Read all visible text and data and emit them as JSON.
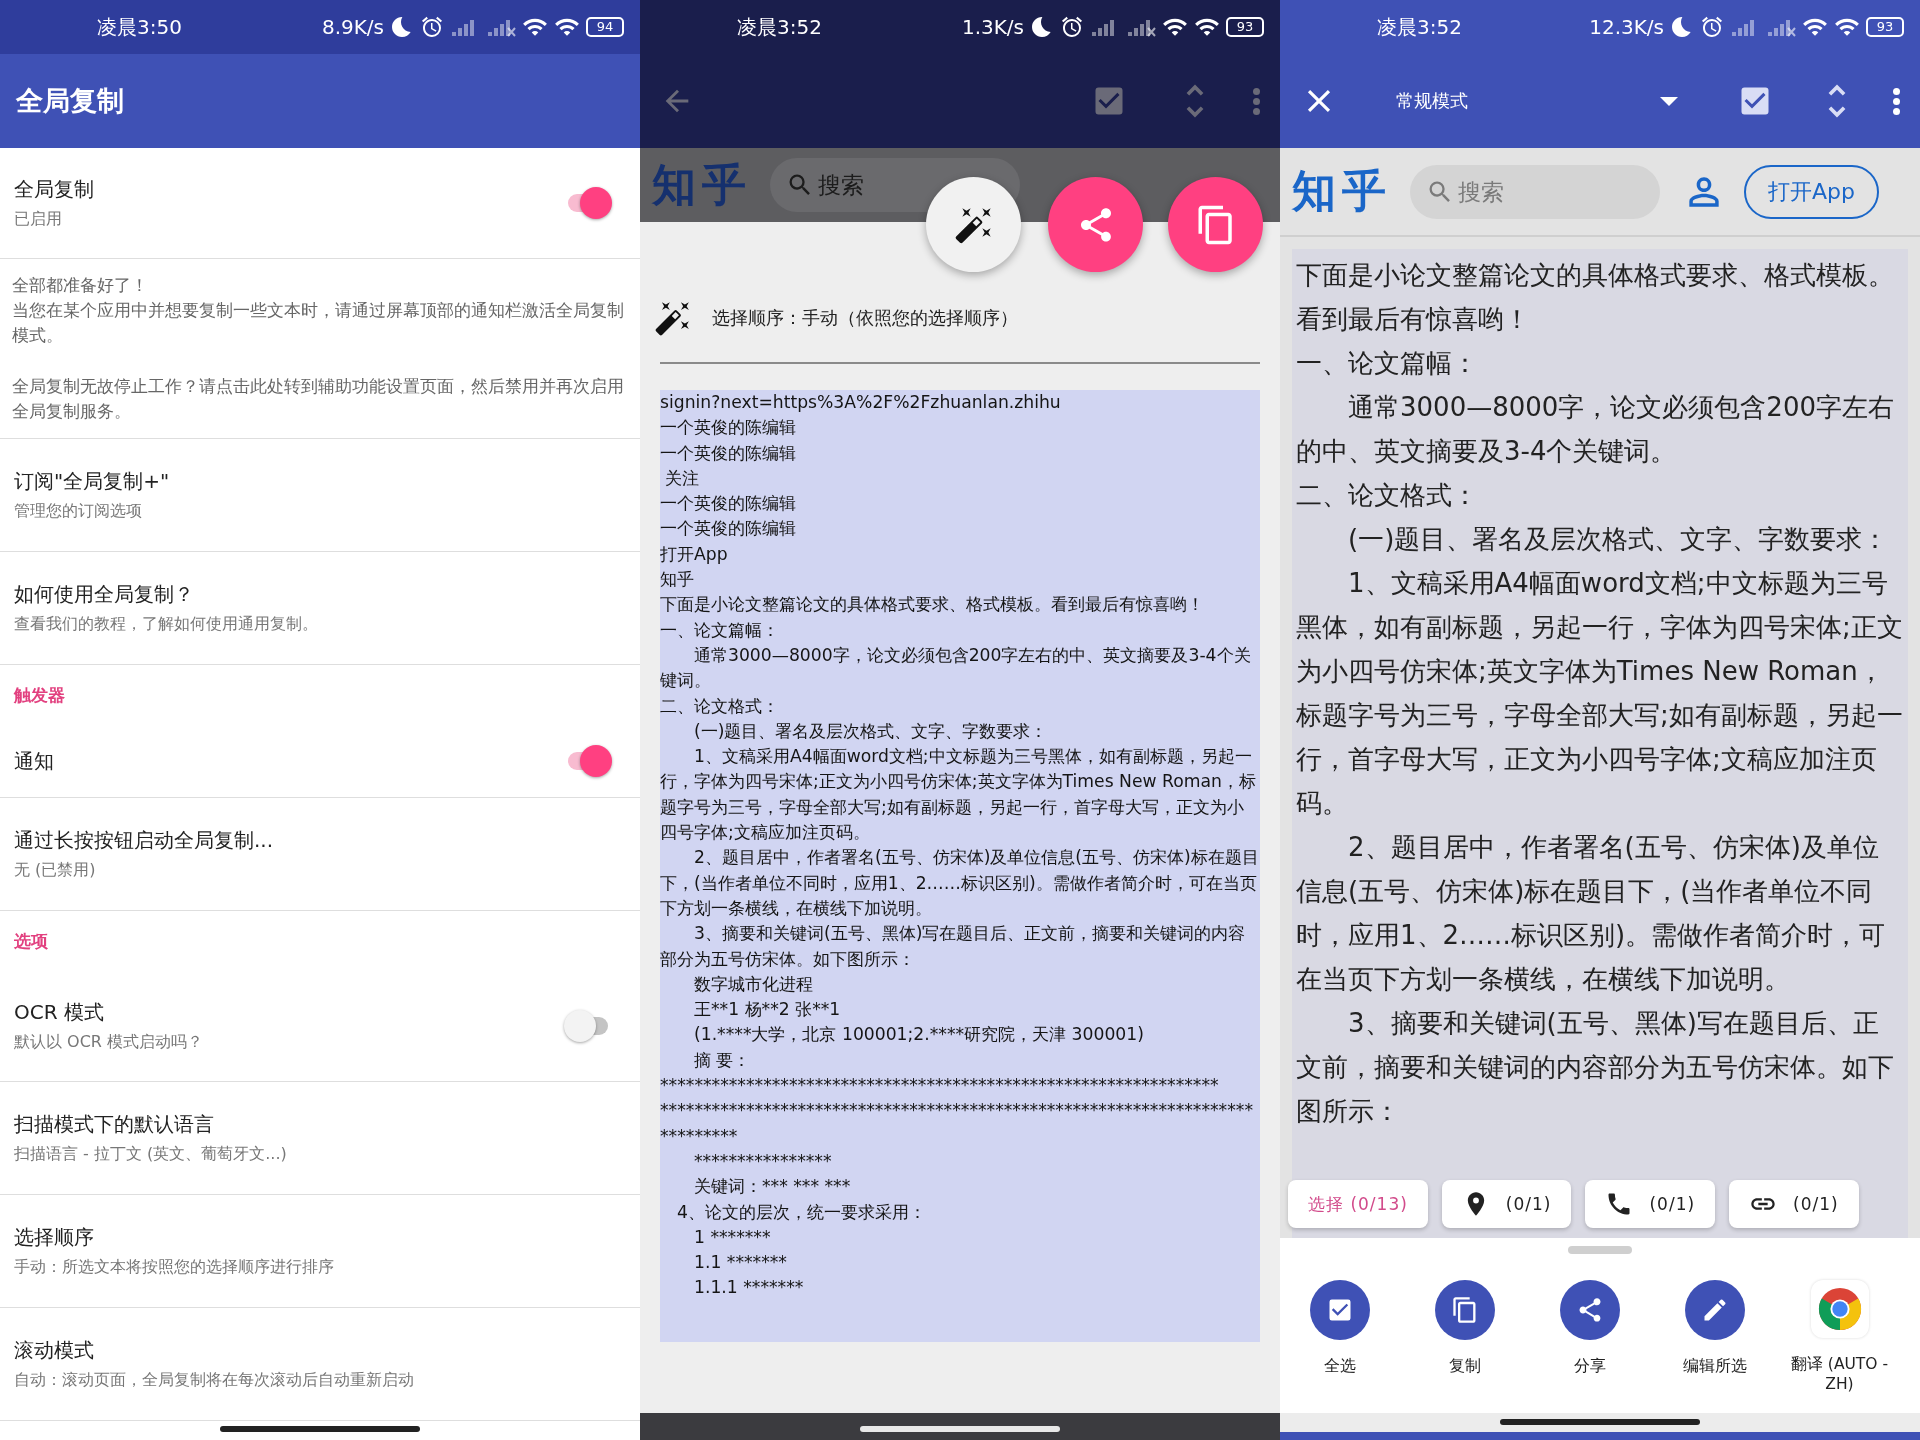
{
  "settings_screen": {
    "status_bar": {
      "time": "凌晨3:50",
      "speed": "8.9K/s",
      "battery": "94"
    },
    "title": "全局复制",
    "items": [
      {
        "kind": "switch",
        "title": "全局复制",
        "subtitle": "已启用",
        "on": true
      },
      {
        "kind": "info",
        "paragraphs": [
          [
            "全部都准备好了！",
            "当您在某个应用中并想要复制一些文本时，请通过屏幕顶部的通知栏激活全局复制模式。"
          ],
          [
            "全局复制无故停止工作？请点击此处转到辅助功能设置页面，然后禁用并再次启用全局复制服务。"
          ]
        ]
      },
      {
        "kind": "item",
        "title": "订阅\"全局复制+\"",
        "subtitle": "管理您的订阅选项"
      },
      {
        "kind": "item",
        "title": "如何使用全局复制？",
        "subtitle": "查看我们的教程，了解如何使用通用复制。"
      },
      {
        "kind": "category",
        "title": "触发器"
      },
      {
        "kind": "switch",
        "title": "通知",
        "on": true
      },
      {
        "kind": "item",
        "title": "通过长按按钮启动全局复制...",
        "subtitle": "无 (已禁用)"
      },
      {
        "kind": "category",
        "title": "选项"
      },
      {
        "kind": "switch",
        "title": "OCR 模式",
        "subtitle": "默认以 OCR 模式启动吗？",
        "on": false
      },
      {
        "kind": "item",
        "title": "扫描模式下的默认语言",
        "subtitle": "扫描语言 - 拉丁文 (英文、葡萄牙文...)"
      },
      {
        "kind": "item",
        "title": "选择顺序",
        "subtitle": "手动：所选文本将按照您的选择顺序进行排序"
      },
      {
        "kind": "item",
        "title": "滚动模式",
        "subtitle": "自动：滚动页面，全局复制将在每次滚动后自动重新启动"
      }
    ]
  },
  "picker_screen": {
    "status_bar": {
      "time": "凌晨3:52",
      "speed": "1.3K/s",
      "battery": "93"
    },
    "site_header": {
      "logo": "知乎",
      "search_placeholder": "搜索"
    },
    "order_option": "选择顺序：手动（依照您的选择顺序）",
    "text_lines": [
      "signin?next=https%3A%2F%2Fzhuanlan.zhihu",
      "一个英俊的陈编辑",
      "一个英俊的陈编辑",
      " 关注",
      "一个英俊的陈编辑",
      "一个英俊的陈编辑",
      "打开App",
      "知乎",
      "下面是小论文整篇论文的具体格式要求、格式模板。看到最后有惊喜哟！",
      "一、论文篇幅：",
      "　　通常3000—8000字，论文必须包含200字左右的中、英文摘要及3-4个关键词。",
      "二、论文格式：",
      "　　(一)题目、署名及层次格式、文字、字数要求：",
      "　　1、文稿采用A4幅面word文档;中文标题为三号黑体，如有副标题，另起一行，字体为四号宋体;正文为小四号仿宋体;英文字体为Times New Roman，标题字号为三号，字母全部大写;如有副标题，另起一行，首字母大写，正文为小四号字体;文稿应加注页码。",
      "　　2、题目居中，作者署名(五号、仿宋体)及单位信息(五号、仿宋体)标在题目下，(当作者单位不同时，应用1、2……标识区别)。需做作者简介时，可在当页下方划一条横线，在横线下加说明。",
      "　　3、摘要和关键词(五号、黑体)写在题目后、正文前，摘要和关键词的内容部分为五号仿宋体。如下图所示：",
      "　　数字城市化进程",
      "　　王**1 杨**2 张**1",
      "　　(1.****大学，北京 100001;2.****研究院，天津 300001)",
      "　　摘 要：",
      "*****************************************************************",
      "******************************************************************************",
      "　　****************",
      "　　关键词：*** *** ***",
      "　4、论文的层次，统一要求采用：",
      "　　1 *******",
      "　　1.1 *******",
      "　　1.1.1 *******"
    ]
  },
  "selection_screen": {
    "status_bar": {
      "time": "凌晨3:52",
      "speed": "12.3K/s",
      "battery": "93"
    },
    "mode": "常规模式",
    "site_header": {
      "logo": "知乎",
      "search_placeholder": "搜索",
      "open_app": "打开App"
    },
    "article": [
      "下面是小论文整篇论文的具体格式要求、格式模板。看到最后有惊喜哟！",
      "一、论文篇幅：",
      "　　通常3000—8000字，论文必须包含200字左右的中、英文摘要及3-4个关键词。",
      "二、论文格式：",
      "　　(一)题目、署名及层次格式、文字、字数要求：",
      "　　1、文稿采用A4幅面word文档;中文标题为三号黑体，如有副标题，另起一行，字体为四号宋体;正文为小四号仿宋体;英文字体为Times New Roman，标题字号为三号，字母全部大写;如有副标题，另起一行，首字母大写，正文为小四号字体;文稿应加注页码。",
      "　　2、题目居中，作者署名(五号、仿宋体)及单位信息(五号、仿宋体)标在题目下，(当作者单位不同时，应用1、2……标识区别)。需做作者简介时，可在当页下方划一条横线，在横线下加说明。",
      "　　3、摘要和关键词(五号、黑体)写在题目后、正文前，摘要和关键词的内容部分为五号仿宋体。如下图所示："
    ],
    "chips": [
      {
        "kind": "select",
        "label": "选择 (0/13)"
      },
      {
        "kind": "location",
        "label": "(0/1)"
      },
      {
        "kind": "phone",
        "label": "(0/1)"
      },
      {
        "kind": "link",
        "label": "(0/1)"
      }
    ],
    "actions": [
      {
        "kind": "select-all",
        "label": "全选"
      },
      {
        "kind": "copy",
        "label": "复制"
      },
      {
        "kind": "share",
        "label": "分享"
      },
      {
        "kind": "edit",
        "label": "编辑所选"
      },
      {
        "kind": "translate",
        "label": "翻译 (AUTO - ZH)"
      }
    ]
  }
}
